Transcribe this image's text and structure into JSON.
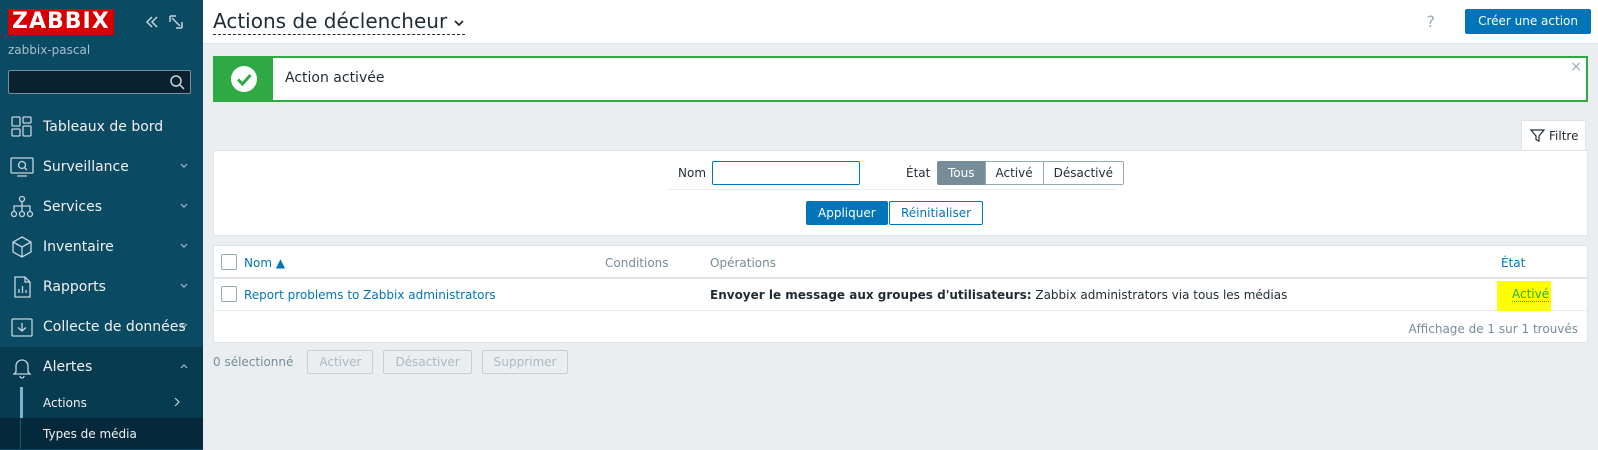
{
  "sidebar": {
    "logo": "ZABBIX",
    "server": "zabbix-pascal",
    "search_placeholder": "",
    "items": [
      {
        "label": "Tableaux de bord",
        "icon": "dashboard-icon"
      },
      {
        "label": "Surveillance",
        "icon": "monitoring-icon"
      },
      {
        "label": "Services",
        "icon": "services-icon"
      },
      {
        "label": "Inventaire",
        "icon": "inventory-icon"
      },
      {
        "label": "Rapports",
        "icon": "reports-icon"
      },
      {
        "label": "Collecte de données",
        "icon": "data-collection-icon"
      },
      {
        "label": "Alertes",
        "icon": "bell-icon"
      }
    ],
    "subitems": [
      {
        "label": "Actions"
      },
      {
        "label": "Types de média"
      }
    ]
  },
  "header": {
    "title": "Actions de déclencheur",
    "help": "?",
    "create_label": "Créer une action"
  },
  "message": {
    "text": "Action activée",
    "close": "×"
  },
  "filter": {
    "tab_label": "Filtre",
    "name_label": "Nom",
    "name_value": "",
    "state_label": "État",
    "state_options": [
      "Tous",
      "Activé",
      "Désactivé"
    ],
    "selected_state": "Tous",
    "apply_label": "Appliquer",
    "reset_label": "Réinitialiser"
  },
  "table": {
    "columns": [
      "Nom ▲",
      "Conditions",
      "Opérations",
      "État"
    ],
    "rows": [
      {
        "name": "Report problems to Zabbix administrators",
        "conditions": "",
        "operation_bold": "Envoyer le message aux groupes d'utilisateurs:",
        "operation_rest": " Zabbix administrators via tous les médias",
        "status": "Activé"
      }
    ],
    "footer": "Affichage de 1 sur 1 trouvés"
  },
  "bottom": {
    "selected": "0 sélectionné",
    "buttons": [
      "Activer",
      "Désactiver",
      "Supprimer"
    ]
  },
  "colors": {
    "sidebar_bg": "#0b4a63",
    "accent": "#0275b8",
    "success": "#2ea944",
    "logo_red": "#d40000",
    "highlight": "#ffff00"
  }
}
